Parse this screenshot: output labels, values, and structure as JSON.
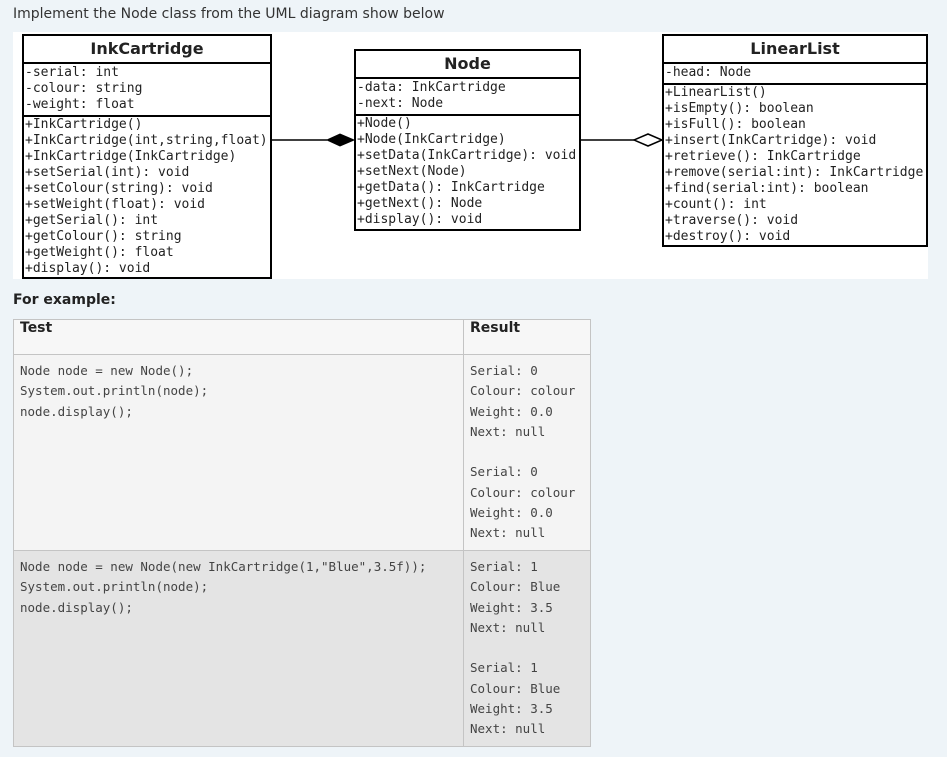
{
  "intro": "Implement the Node class from the UML diagram show below",
  "uml": {
    "ink_cartridge": {
      "name": "InkCartridge",
      "attributes": [
        "-serial: int",
        "-colour: string",
        "-weight: float"
      ],
      "operations": [
        "+InkCartridge()",
        "+InkCartridge(int,string,float)",
        "+InkCartridge(InkCartridge)",
        "+setSerial(int): void",
        "+setColour(string): void",
        "+setWeight(float): void",
        "+getSerial(): int",
        "+getColour(): string",
        "+getWeight(): float",
        "+display(): void"
      ]
    },
    "node": {
      "name": "Node",
      "attributes": [
        "-data: InkCartridge",
        "-next: Node"
      ],
      "operations": [
        "+Node()",
        "+Node(InkCartridge)",
        "+setData(InkCartridge): void",
        "+setNext(Node)",
        "+getData(): InkCartridge",
        "+getNext(): Node",
        "+display(): void"
      ]
    },
    "linear_list": {
      "name": "LinearList",
      "attributes": [
        "-head: Node"
      ],
      "operations": [
        "+LinearList()",
        "+isEmpty(): boolean",
        "+isFull(): boolean",
        "+insert(InkCartridge): void",
        "+retrieve(): InkCartridge",
        "+remove(serial:int): InkCartridge",
        "+find(serial:int): boolean",
        "+count(): int",
        "+traverse(): void",
        "+destroy(): void"
      ]
    }
  },
  "example_label": "For example:",
  "table": {
    "headers": [
      "Test",
      "Result"
    ],
    "rows": [
      {
        "test": "Node node = new Node();\nSystem.out.println(node);\nnode.display();",
        "result": "Serial: 0\nColour: colour\nWeight: 0.0\nNext: null\n\nSerial: 0\nColour: colour\nWeight: 0.0\nNext: null"
      },
      {
        "test": "Node node = new Node(new InkCartridge(1,\"Blue\",3.5f));\nSystem.out.println(node);\nnode.display();",
        "result": "Serial: 1\nColour: Blue\nWeight: 3.5\nNext: null\n\nSerial: 1\nColour: Blue\nWeight: 3.5\nNext: null"
      }
    ]
  }
}
